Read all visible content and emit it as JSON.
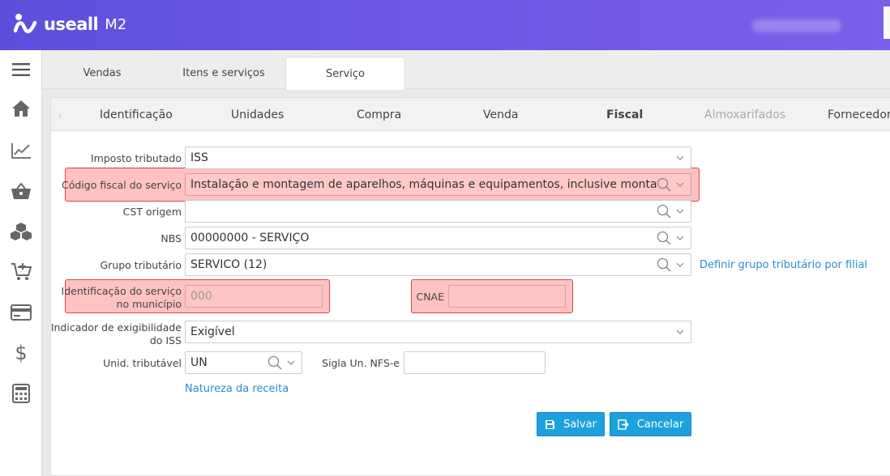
{
  "app": {
    "logo_text": "useall",
    "logo_sub": "M2"
  },
  "sidebar": {
    "items": [
      {
        "icon": "menu-icon"
      },
      {
        "icon": "home-icon"
      },
      {
        "icon": "chart-icon"
      },
      {
        "icon": "basket-icon"
      },
      {
        "icon": "boxes-icon"
      },
      {
        "icon": "cart-add-icon"
      },
      {
        "icon": "card-icon"
      },
      {
        "icon": "dollar-icon"
      },
      {
        "icon": "calculator-icon"
      }
    ]
  },
  "top_tabs": [
    {
      "label": "Vendas"
    },
    {
      "label": "Itens e serviços"
    },
    {
      "label": "Serviço"
    }
  ],
  "sub_tabs": [
    {
      "label": "Identificação"
    },
    {
      "label": "Unidades"
    },
    {
      "label": "Compra"
    },
    {
      "label": "Venda"
    },
    {
      "label": "Fiscal"
    },
    {
      "label": "Almoxarifados"
    },
    {
      "label": "Fornecedore"
    }
  ],
  "form": {
    "imposto_label": "Imposto tributado",
    "imposto_value": "ISS",
    "codigo_label": "Código fiscal do serviço",
    "codigo_value": "Instalação e montagem de aparelhos, máquinas e equipamentos, inclusive montagem ind",
    "cst_label": "CST origem",
    "cst_value": "",
    "nbs_label": "NBS",
    "nbs_value": "00000000 - SERVIÇO",
    "grupo_label": "Grupo tributário",
    "grupo_value": "SERVICO (12)",
    "grupo_link": "Definir grupo tributário por filial",
    "ident_label_1": "Identificação do serviço",
    "ident_label_2": "no município",
    "ident_placeholder": "000",
    "cnae_label": "CNAE",
    "cnae_value": "",
    "exig_label_1": "Indicador de exigibilidade",
    "exig_label_2": "do ISS",
    "exig_value": "Exigível",
    "unid_label": "Unid. tributável",
    "unid_value": "UN",
    "sigla_label": "Sigla Un. NFS-e",
    "sigla_value": "",
    "natureza_link": "Natureza da receita"
  },
  "actions": {
    "save": "Salvar",
    "cancel": "Cancelar"
  },
  "colors": {
    "topbar": "#6656e2",
    "accent": "#1da1dc",
    "link": "#2a8dc8",
    "highlight": "#ff7878"
  }
}
